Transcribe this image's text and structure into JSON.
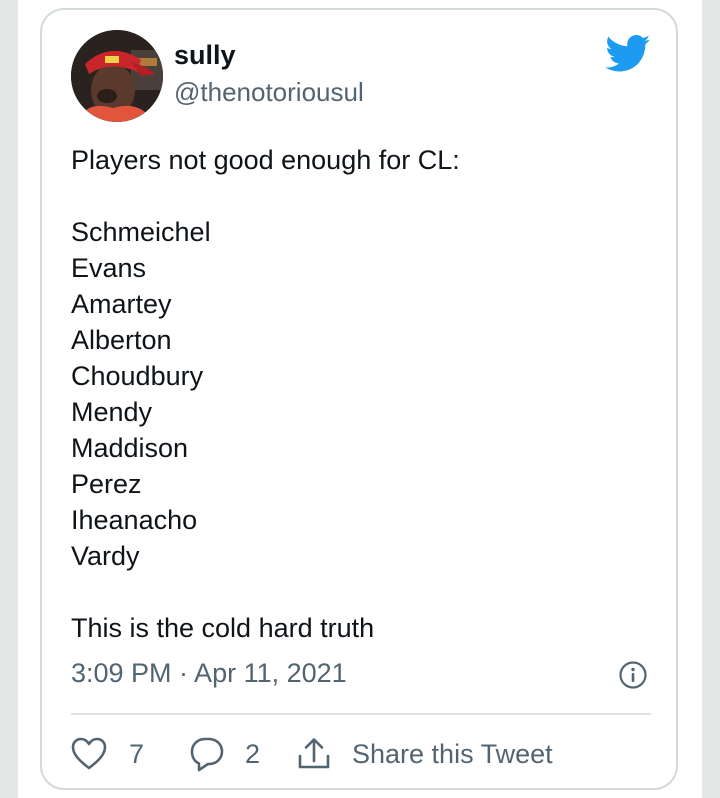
{
  "tweet": {
    "display_name": "sully",
    "handle": "@thenotoriousul",
    "intro": "Players not good enough for CL:",
    "players": [
      "Schmeichel",
      "Evans",
      "Amartey",
      "Alberton",
      "Choudbury",
      "Mendy",
      "Maddison",
      "Perez",
      "Iheanacho",
      "Vardy"
    ],
    "closing": "This is the cold hard truth",
    "timestamp": "3:09 PM · Apr 11, 2021"
  },
  "actions": {
    "like_count": "7",
    "reply_count": "2",
    "share_label": "Share this Tweet"
  },
  "icons": {
    "brand": "twitter-bird-icon",
    "info": "info-icon",
    "like": "heart-icon",
    "reply": "speech-bubble-icon",
    "share": "share-arrow-icon"
  },
  "colors": {
    "twitter_blue": "#1d9bf0",
    "text_primary": "#0f1419",
    "text_secondary": "#536471",
    "border": "#d4d9dc"
  }
}
